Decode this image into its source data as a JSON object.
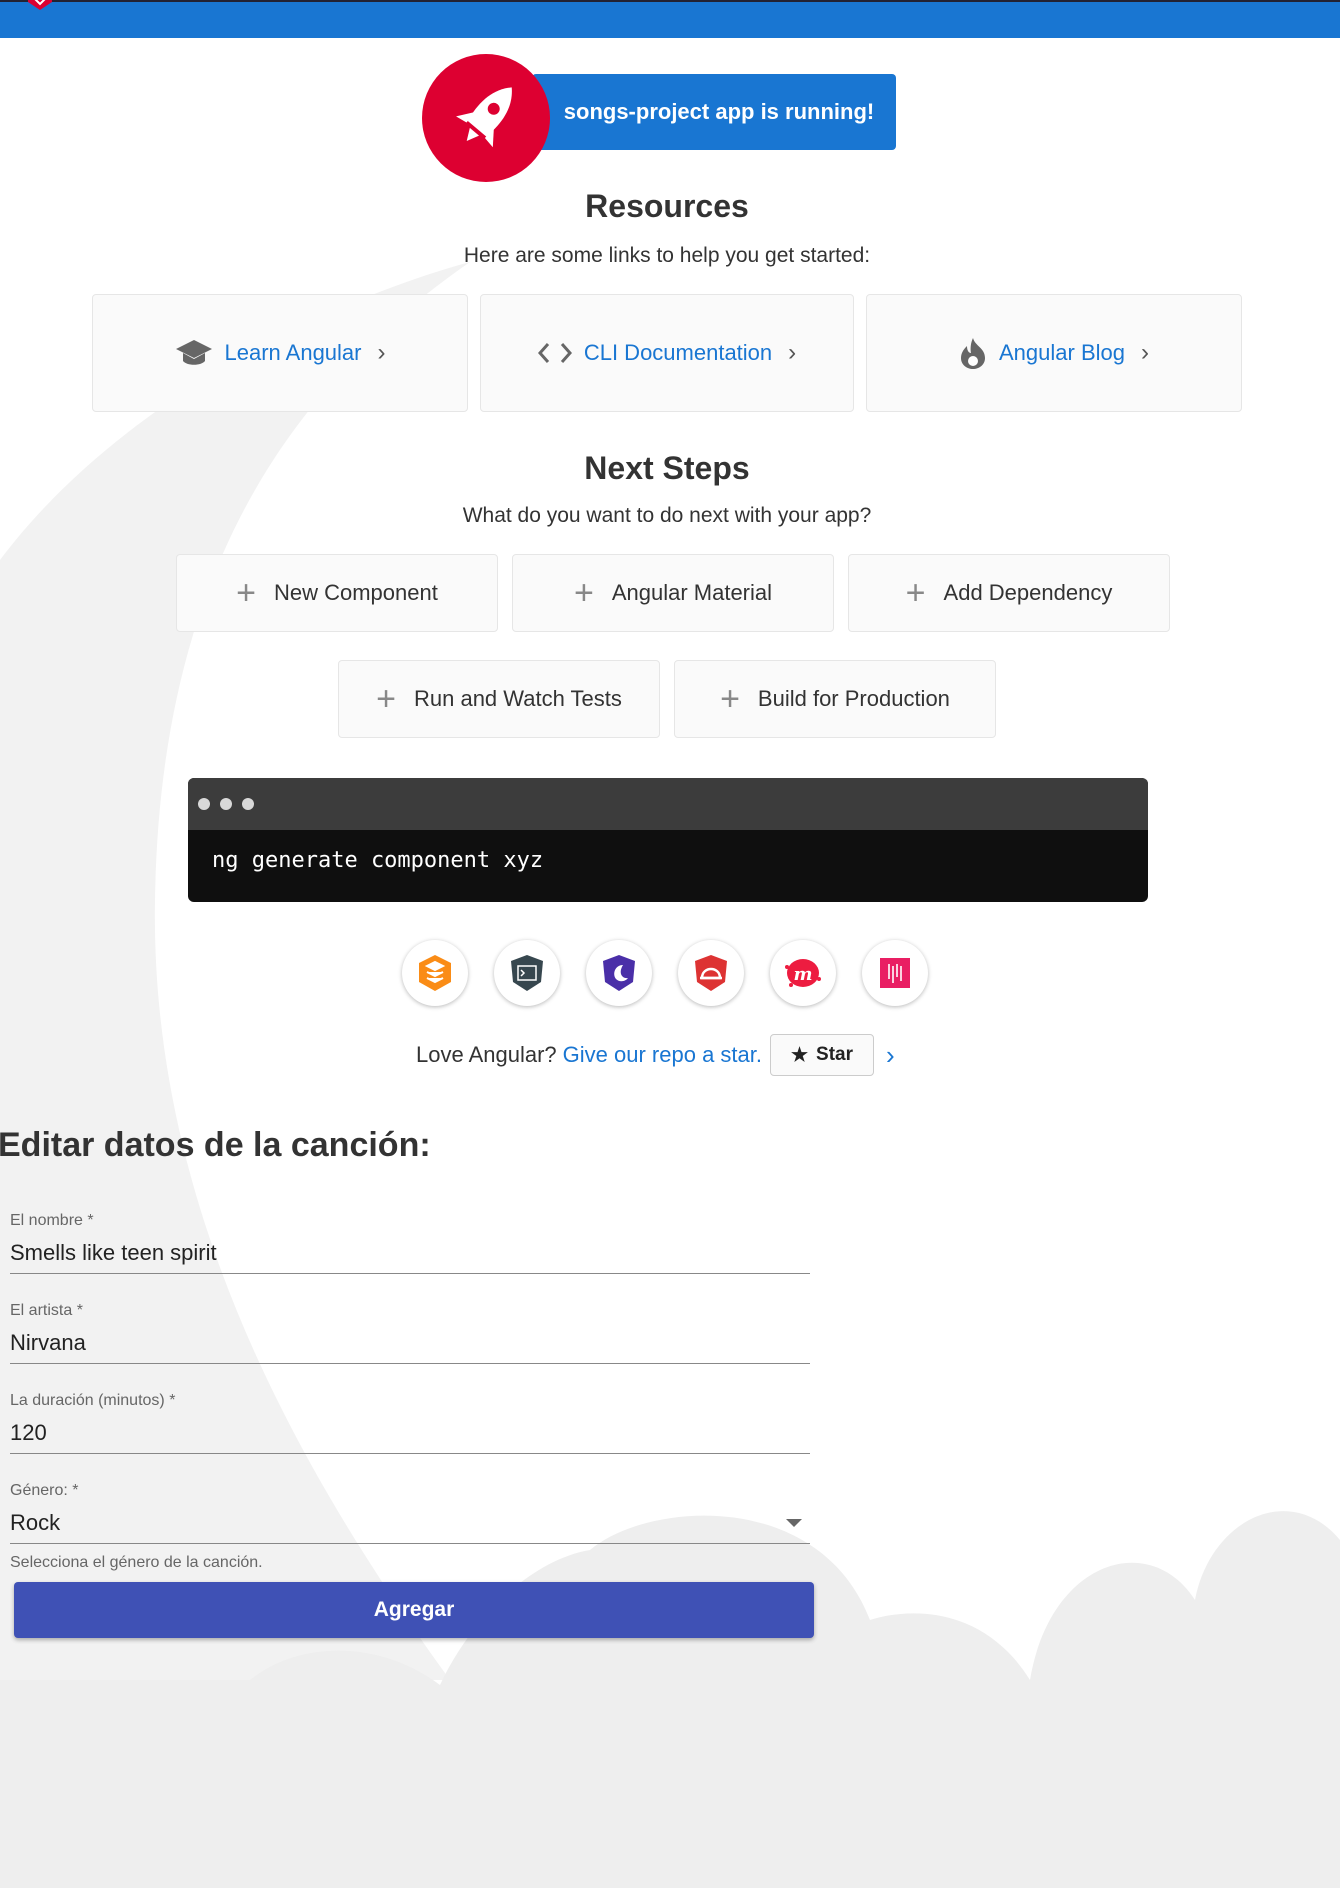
{
  "banner": {
    "text": "songs-project app is running!"
  },
  "resources": {
    "title": "Resources",
    "subtitle": "Here are some links to help you get started:",
    "cards": [
      {
        "label": "Learn Angular",
        "icon": "graduation-cap-icon"
      },
      {
        "label": "CLI Documentation",
        "icon": "code-brackets-icon"
      },
      {
        "label": "Angular Blog",
        "icon": "flame-icon"
      }
    ]
  },
  "next_steps": {
    "title": "Next Steps",
    "subtitle": "What do you want to do next with your app?",
    "buttons": [
      "New Component",
      "Angular Material",
      "Add Dependency",
      "Run and Watch Tests",
      "Build for Production"
    ]
  },
  "terminal": {
    "command": "ng generate component xyz"
  },
  "tools": [
    "animations-icon",
    "cli-icon",
    "augury-icon",
    "protractor-icon",
    "meetup-icon",
    "discord-icon"
  ],
  "star_row": {
    "text": "Love Angular?",
    "link": "Give our repo a star.",
    "button": "Star"
  },
  "form": {
    "title": "Editar datos de la canción:",
    "fields": [
      {
        "label": "El nombre *",
        "value": "Smells like teen spirit"
      },
      {
        "label": "El artista *",
        "value": "Nirvana"
      },
      {
        "label": "La duración (minutos) *",
        "value": "120"
      },
      {
        "label": "Género: *",
        "value": "Rock"
      }
    ],
    "hint": "Selecciona el género de la canción.",
    "submit": "Agregar"
  },
  "colors": {
    "primary": "#1976d2",
    "angular_red": "#dd0031",
    "form_button": "#3f51b5"
  }
}
